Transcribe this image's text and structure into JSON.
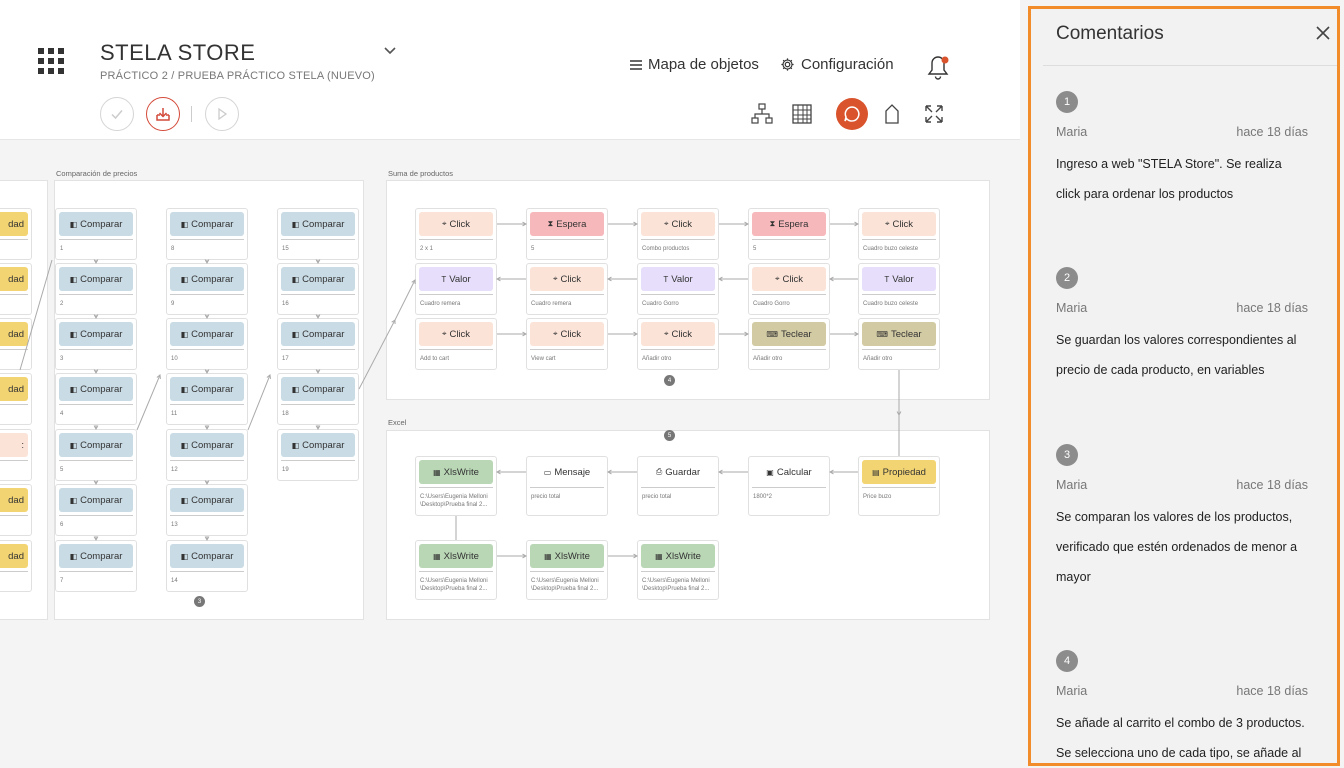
{
  "header": {
    "title": "STELA STORE",
    "subtitle": "PRÁCTICO 2 / PRUEBA PRÁCTICO STELA (NUEVO)",
    "nav": {
      "object_map": "Mapa de objetos",
      "settings": "Configuración"
    }
  },
  "colors": {
    "accent": "#d9532c",
    "highlight": "#f28b2a"
  },
  "canvas": {
    "groups": {
      "compare": "Comparación de precios",
      "sum": "Suma de productos",
      "excel": "Excel"
    },
    "left_partial": [
      "dad",
      "dad",
      "dad",
      "dad",
      ":",
      "dad",
      "dad"
    ],
    "compare_nodes": {
      "label": "Comparar",
      "col1": [
        "1",
        "2",
        "3",
        "4",
        "5",
        "6",
        "7"
      ],
      "col2": [
        "8",
        "9",
        "10",
        "11",
        "12",
        "13",
        "14"
      ],
      "col3": [
        "15",
        "16",
        "17",
        "18",
        "19"
      ]
    },
    "sum_row1": [
      {
        "label": "Click",
        "sub": "2 x 1"
      },
      {
        "label": "Espera",
        "sub": "5"
      },
      {
        "label": "Click",
        "sub": "Combo productos"
      },
      {
        "label": "Espera",
        "sub": "5"
      },
      {
        "label": "Click",
        "sub": "Cuadro buzo celeste"
      }
    ],
    "sum_row2": [
      {
        "label": "Valor",
        "sub": "Cuadro remera"
      },
      {
        "label": "Click",
        "sub": "Cuadro remera"
      },
      {
        "label": "Valor",
        "sub": "Cuadro Gorro"
      },
      {
        "label": "Click",
        "sub": "Cuadro Gorro"
      },
      {
        "label": "Valor",
        "sub": "Cuadro buzo celeste"
      }
    ],
    "sum_row3": [
      {
        "label": "Click",
        "sub": "Add to cart"
      },
      {
        "label": "Click",
        "sub": "View cart"
      },
      {
        "label": "Click",
        "sub": "Añadir otro"
      },
      {
        "label": "Teclear",
        "sub": "Añadir otro"
      },
      {
        "label": "Teclear",
        "sub": "Añadir otro"
      }
    ],
    "excel_row1": [
      {
        "label": "XlsWrite",
        "sub": "C:\\Users\\Eugenia Melloni\n\\Desktop\\Prueba final 2..."
      },
      {
        "label": "Mensaje",
        "sub": "precio total"
      },
      {
        "label": "Guardar",
        "sub": "precio total"
      },
      {
        "label": "Calcular",
        "sub": "1800*2"
      },
      {
        "label": "Propiedad",
        "sub": "Price buzo"
      }
    ],
    "excel_row2": [
      {
        "label": "XlsWrite",
        "sub": "C:\\Users\\Eugenia Melloni\n\\Desktop\\Prueba final 2..."
      },
      {
        "label": "XlsWrite",
        "sub": "C:\\Users\\Eugenia Melloni\n\\Desktop\\Prueba final 2..."
      },
      {
        "label": "XlsWrite",
        "sub": "C:\\Users\\Eugenia Melloni\n\\Desktop\\Prueba final 2..."
      }
    ],
    "badges": {
      "compare": "3",
      "sum": "4",
      "excel": "5"
    }
  },
  "comments_panel": {
    "title": "Comentarios",
    "items": [
      {
        "num": "1",
        "author": "Maria",
        "date": "hace 18 días",
        "text": "Ingreso a web \"STELA Store\". Se realiza click para ordenar los productos"
      },
      {
        "num": "2",
        "author": "Maria",
        "date": "hace 18 días",
        "text": "Se guardan los valores correspondientes al precio de cada producto, en variables"
      },
      {
        "num": "3",
        "author": "Maria",
        "date": "hace 18 días",
        "text": "Se comparan los valores de los productos, verificado que estén ordenados de menor a mayor"
      },
      {
        "num": "4",
        "author": "Maria",
        "date": "hace 18 días",
        "text": "Se añade al carrito el combo de 3 productos. Se selecciona uno de cada tipo, se añade al"
      }
    ]
  }
}
